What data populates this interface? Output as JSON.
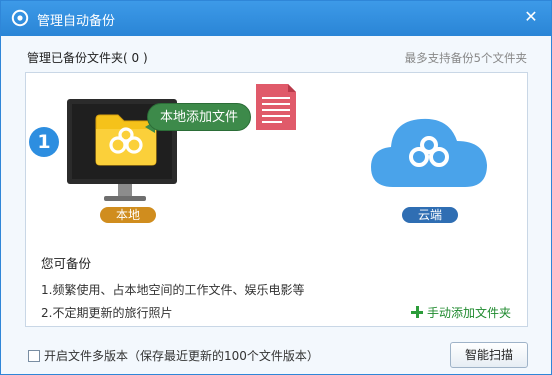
{
  "window": {
    "title": "管理自动备份",
    "close_icon": "✕"
  },
  "section": {
    "title": "管理已备份文件夹( 0 )",
    "hint": "最多支持备份5个文件夹"
  },
  "illustration": {
    "step_number": "1",
    "bubble_text": "本地添加文件",
    "local_label": "本地",
    "cloud_label": "云端",
    "folder_color": "#f5c21a",
    "cloud_color": "#4aa3ea"
  },
  "info": {
    "heading": "您可备份",
    "items": [
      "1.频繁使用、占本地空间的工作文件、娱乐电影等",
      "2.不定期更新的旅行照片"
    ]
  },
  "actions": {
    "manual_add_label": "手动添加文件夹",
    "multi_version_label": "开启文件多版本（保存最近更新的100个文件版本）",
    "multi_version_checked": false,
    "smart_scan_label": "智能扫描"
  }
}
